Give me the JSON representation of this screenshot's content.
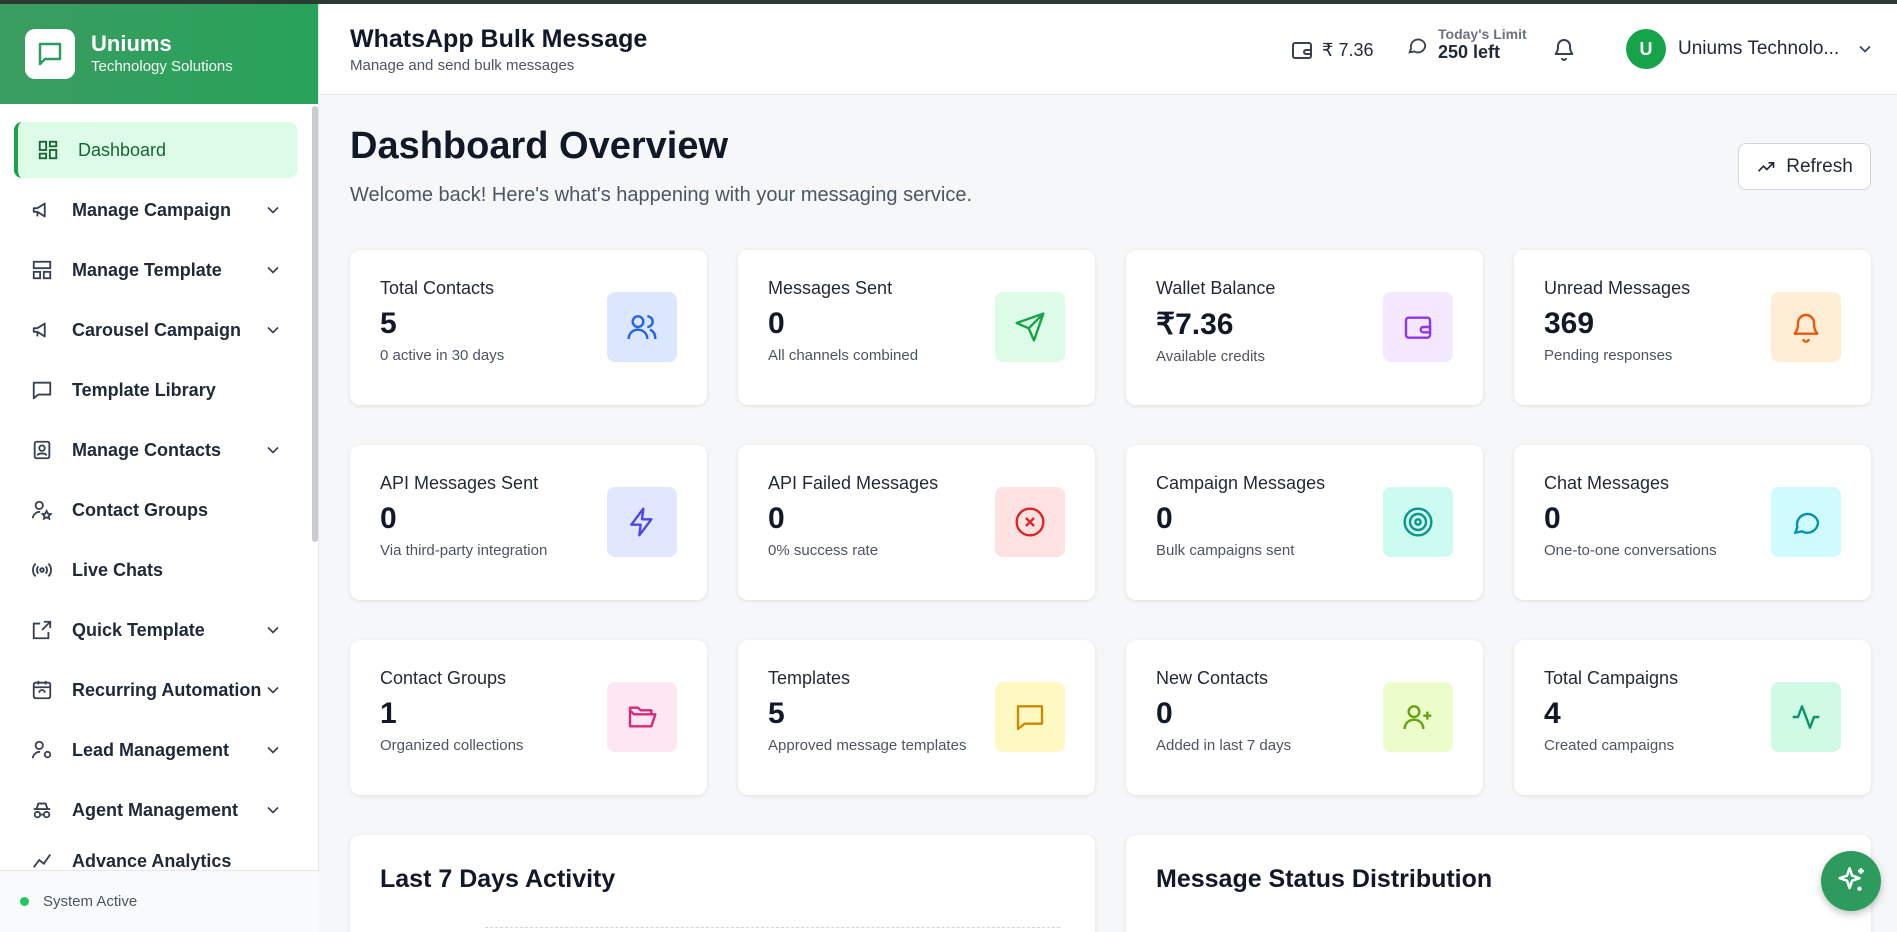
{
  "brand": {
    "name": "Uniums",
    "subtitle": "Technology Solutions"
  },
  "sidebar": {
    "items": [
      {
        "label": "Dashboard",
        "icon": "dashboard-icon",
        "active": true
      },
      {
        "label": "Manage Campaign",
        "icon": "megaphone-icon",
        "expandable": true
      },
      {
        "label": "Manage Template",
        "icon": "layout-icon",
        "expandable": true
      },
      {
        "label": "Carousel Campaign",
        "icon": "megaphone-icon",
        "expandable": true
      },
      {
        "label": "Template Library",
        "icon": "message-square-icon"
      },
      {
        "label": "Manage Contacts",
        "icon": "contact-icon",
        "expandable": true
      },
      {
        "label": "Contact Groups",
        "icon": "user-star-icon"
      },
      {
        "label": "Live Chats",
        "icon": "radio-icon"
      },
      {
        "label": "Quick Template",
        "icon": "external-link-icon",
        "expandable": true
      },
      {
        "label": "Recurring Automation",
        "icon": "calendar-sync-icon",
        "expandable": true
      },
      {
        "label": "Lead Management",
        "icon": "user-cog-icon",
        "expandable": true
      },
      {
        "label": "Agent Management",
        "icon": "spy-icon",
        "expandable": true
      },
      {
        "label": "Advance Analytics",
        "icon": "chart-icon"
      }
    ],
    "status": "System Active"
  },
  "header": {
    "title": "WhatsApp Bulk Message",
    "subtitle": "Manage and send bulk messages",
    "wallet": "₹ 7.36",
    "limit_label": "Today's Limit",
    "limit_value": "250 left",
    "user_initial": "U",
    "user_name": "Uniums Technolo..."
  },
  "main": {
    "title": "Dashboard Overview",
    "subtitle": "Welcome back! Here's what's happening with your messaging service.",
    "refresh_label": "Refresh"
  },
  "cards": [
    {
      "title": "Total Contacts",
      "value": "5",
      "sub": "0 active in 30 days",
      "icon": "users-icon",
      "bg": "#dbe7fd",
      "fg": "#2563eb"
    },
    {
      "title": "Messages Sent",
      "value": "0",
      "sub": "All channels combined",
      "icon": "send-icon",
      "bg": "#dcfce7",
      "fg": "#16a34a"
    },
    {
      "title": "Wallet Balance",
      "value": "₹7.36",
      "sub": "Available credits",
      "icon": "wallet-icon",
      "bg": "#f3e8ff",
      "fg": "#9333ea"
    },
    {
      "title": "Unread Messages",
      "value": "369",
      "sub": "Pending responses",
      "icon": "bell-icon",
      "bg": "#ffedd5",
      "fg": "#ea580c"
    },
    {
      "title": "API Messages Sent",
      "value": "0",
      "sub": "Via third-party integration",
      "icon": "zap-icon",
      "bg": "#e0e7ff",
      "fg": "#4f46e5"
    },
    {
      "title": "API Failed Messages",
      "value": "0",
      "sub": "0% success rate",
      "icon": "x-circle-icon",
      "bg": "#fee2e2",
      "fg": "#dc2626"
    },
    {
      "title": "Campaign Messages",
      "value": "0",
      "sub": "Bulk campaigns sent",
      "icon": "target-icon",
      "bg": "#ccfbf1",
      "fg": "#0d9488"
    },
    {
      "title": "Chat Messages",
      "value": "0",
      "sub": "One-to-one conversations",
      "icon": "chat-bubble-icon",
      "bg": "#cffafe",
      "fg": "#0891b2"
    },
    {
      "title": "Contact Groups",
      "value": "1",
      "sub": "Organized collections",
      "icon": "folder-open-icon",
      "bg": "#fce7f3",
      "fg": "#db2777"
    },
    {
      "title": "Templates",
      "value": "5",
      "sub": "Approved message templates",
      "icon": "message-square-icon",
      "bg": "#fef9c3",
      "fg": "#ca8a04"
    },
    {
      "title": "New Contacts",
      "value": "0",
      "sub": "Added in last 7 days",
      "icon": "user-plus-icon",
      "bg": "#ecfccb",
      "fg": "#65a30d"
    },
    {
      "title": "Total Campaigns",
      "value": "4",
      "sub": "Created campaigns",
      "icon": "activity-icon",
      "bg": "#d1fae5",
      "fg": "#059669"
    }
  ],
  "panels": [
    {
      "title": "Last 7 Days Activity"
    },
    {
      "title": "Message Status Distribution"
    }
  ]
}
